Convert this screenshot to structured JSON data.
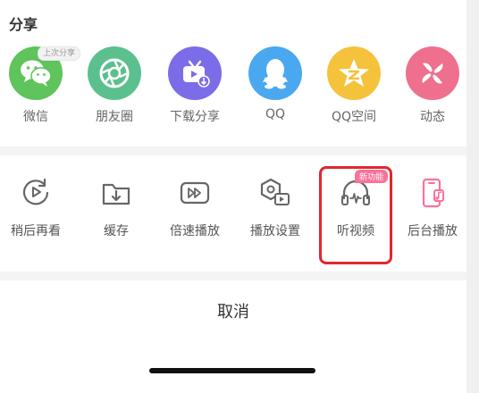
{
  "share": {
    "title": "分享",
    "last_share_badge": "上次分享",
    "items": [
      {
        "label": "微信",
        "icon": "wechat-icon",
        "color": "#5ec45b"
      },
      {
        "label": "朋友圈",
        "icon": "moments-icon",
        "color": "#5bc08d"
      },
      {
        "label": "下载分享",
        "icon": "download-share-icon",
        "color": "#7b6ce8"
      },
      {
        "label": "QQ",
        "icon": "qq-icon",
        "color": "#4aa8f0"
      },
      {
        "label": "QQ空间",
        "icon": "qzone-icon",
        "color": "#f5c23b"
      },
      {
        "label": "动态",
        "icon": "dynamic-icon",
        "color": "#ef6f8e"
      }
    ]
  },
  "actions": {
    "new_badge": "新功能",
    "items": [
      {
        "label": "稍后再看",
        "icon": "watch-later-icon"
      },
      {
        "label": "缓存",
        "icon": "cache-icon"
      },
      {
        "label": "倍速播放",
        "icon": "speed-play-icon"
      },
      {
        "label": "播放设置",
        "icon": "play-settings-icon"
      },
      {
        "label": "听视频",
        "icon": "listen-video-icon"
      },
      {
        "label": "后台播放",
        "icon": "background-play-icon"
      }
    ]
  },
  "cancel_label": "取消",
  "colors": {
    "accent_pink": "#fb7299",
    "highlight_red": "#e0282d"
  }
}
